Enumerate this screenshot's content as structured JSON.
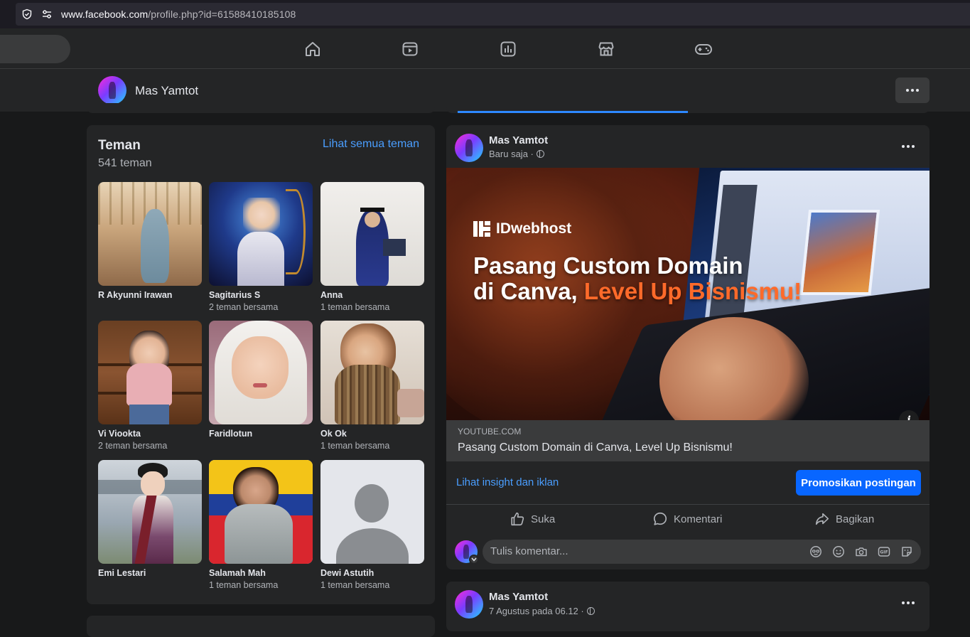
{
  "browser": {
    "url_domain": "www.facebook.com",
    "url_path": "/profile.php?id=61588410185108"
  },
  "topnav": {
    "icons": [
      "home-icon",
      "video-icon",
      "feeds-icon",
      "marketplace-icon",
      "gaming-icon"
    ]
  },
  "profile": {
    "name": "Mas Yamtot"
  },
  "friends": {
    "title": "Teman",
    "count": "541 teman",
    "see_all": "Lihat semua teman",
    "items": [
      {
        "name": "R Akyunni Irawan",
        "mutual": ""
      },
      {
        "name": "Sagitarius S",
        "mutual": "2 teman bersama"
      },
      {
        "name": "Anna",
        "mutual": "1 teman bersama"
      },
      {
        "name": "Vi Viookta",
        "mutual": "2 teman bersama"
      },
      {
        "name": "Faridlotun",
        "mutual": ""
      },
      {
        "name": "Ok Ok",
        "mutual": "1 teman bersama"
      },
      {
        "name": "Emi Lestari",
        "mutual": ""
      },
      {
        "name": "Salamah Mah",
        "mutual": "1 teman bersama"
      },
      {
        "name": "Dewi Astutih",
        "mutual": "1 teman bersama"
      }
    ]
  },
  "post": {
    "author": "Mas Yamtot",
    "time": "Baru saja ·",
    "image": {
      "brand": "IDwebhost",
      "headline_line1": "Pasang Custom Domain",
      "headline_line2_white": "di Canva, ",
      "headline_line2_orange": "Level Up Bisnismu!"
    },
    "link_domain": "YOUTUBE.COM",
    "link_title": "Pasang Custom Domain di Canva, Level Up Bisnismu!",
    "insight_label": "Lihat insight dan iklan",
    "promote_label": "Promosikan postingan",
    "actions": {
      "like": "Suka",
      "comment": "Komentari",
      "share": "Bagikan"
    },
    "comment_placeholder": "Tulis komentar..."
  },
  "post2": {
    "author": "Mas Yamtot",
    "time": "7 Agustus pada 06.12 ·"
  },
  "colors": {
    "background": "#18191a",
    "card": "#242526",
    "accent_blue": "#0866ff",
    "link_blue": "#4a9eff",
    "headline_orange": "#ff6a2a"
  }
}
